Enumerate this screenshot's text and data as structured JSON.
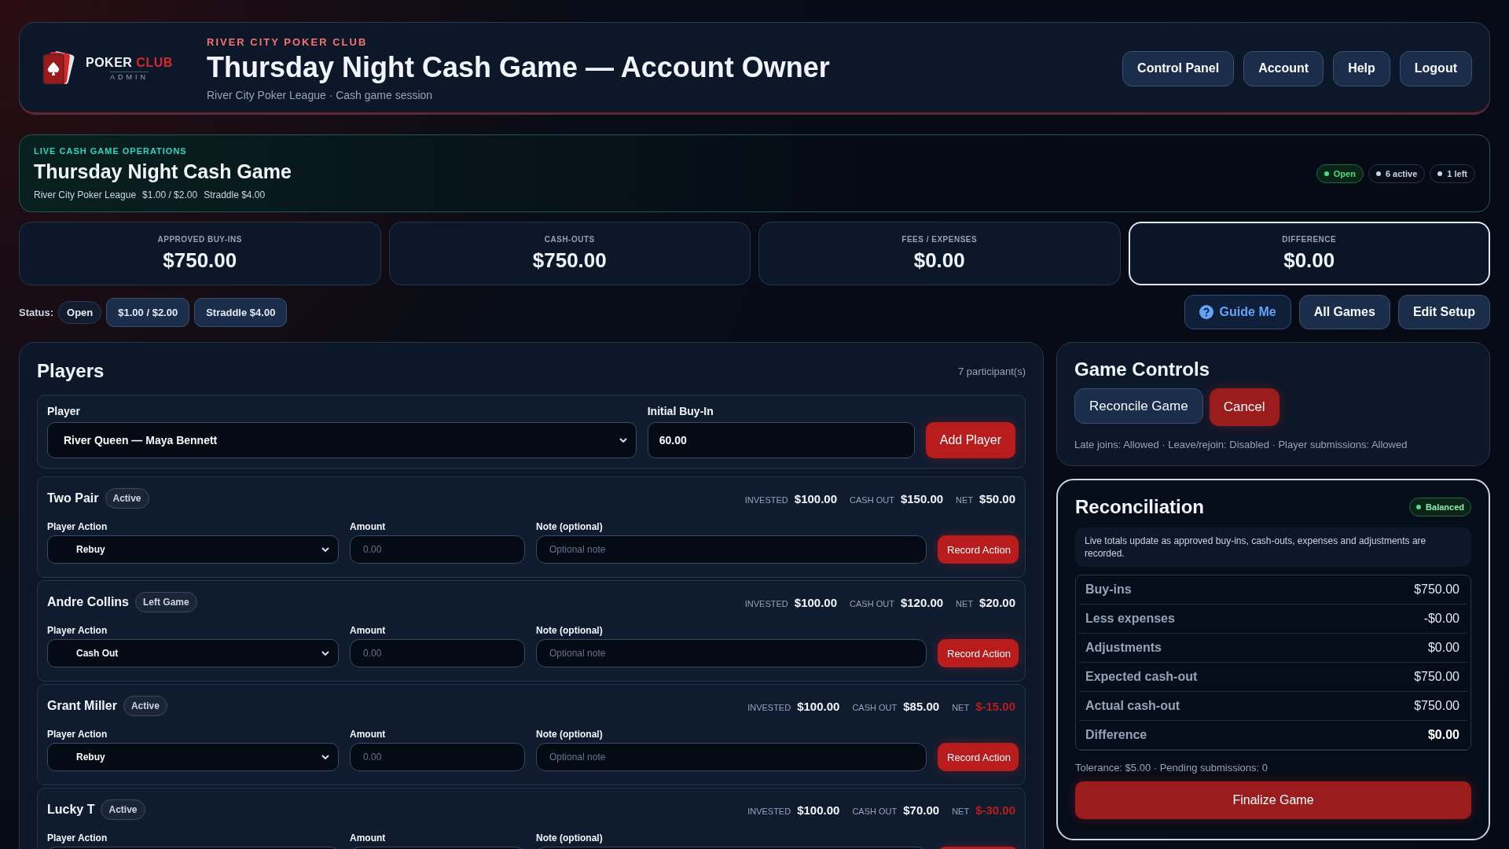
{
  "logo": {
    "word": "POKER",
    "accent": "CLUB",
    "sub": "ADMIN"
  },
  "header": {
    "eyebrow": "RIVER CITY POKER CLUB",
    "title": "Thursday Night Cash Game — Account Owner",
    "subtitle": "River City Poker League · Cash game session",
    "nav": [
      "Control Panel",
      "Account",
      "Help",
      "Logout"
    ]
  },
  "operations": {
    "eyebrow": "LIVE CASH GAME OPERATIONS",
    "title": "Thursday Night Cash Game",
    "meta": [
      "River City Poker League",
      "$1.00 / $2.00",
      "Straddle $4.00"
    ],
    "badges": [
      {
        "label": "Open",
        "kind": "ok"
      },
      {
        "label": "6 active",
        "kind": "neutral"
      },
      {
        "label": "1 left",
        "kind": "neutral"
      }
    ]
  },
  "stats": [
    {
      "label": "APPROVED BUY-INS",
      "value": "$750.00",
      "selected": false
    },
    {
      "label": "CASH-OUTS",
      "value": "$750.00",
      "selected": false
    },
    {
      "label": "FEES / EXPENSES",
      "value": "$0.00",
      "selected": false
    },
    {
      "label": "DIFFERENCE",
      "value": "$0.00",
      "selected": true
    }
  ],
  "status_bar": {
    "label": "Status:",
    "chips": [
      {
        "label": "Open",
        "kind": "plain"
      },
      {
        "label": "$1.00 / $2.00",
        "kind": "pill"
      },
      {
        "label": "Straddle $4.00",
        "kind": "pill"
      }
    ],
    "actions": [
      {
        "label": "Guide Me",
        "kind": "guide"
      },
      {
        "label": "All Games",
        "kind": "normal"
      },
      {
        "label": "Edit Setup",
        "kind": "normal"
      }
    ]
  },
  "players": {
    "title": "Players",
    "count": "7 participant(s)",
    "add": {
      "player_label": "Player",
      "player_value": "River Queen — Maya Bennett",
      "buyin_label": "Initial Buy-In",
      "buyin_value": "60.00",
      "button": "Add Player"
    },
    "rows": [
      {
        "name": "Two Pair",
        "status": "Active",
        "invested_label": "INVESTED",
        "invested": "$100.00",
        "cashout_label": "CASH OUT",
        "cashout": "$150.00",
        "net_label": "NET",
        "net": "$50.00",
        "negative": false,
        "action_label": "Player Action",
        "action": "Rebuy",
        "amount_label": "Amount",
        "amount_placeholder": "0.00",
        "note_label": "Note (optional)",
        "note_placeholder": "Optional note",
        "button": "Record Action"
      },
      {
        "name": "Andre Collins",
        "status": "Left Game",
        "invested_label": "INVESTED",
        "invested": "$100.00",
        "cashout_label": "CASH OUT",
        "cashout": "$120.00",
        "net_label": "NET",
        "net": "$20.00",
        "negative": false,
        "action_label": "Player Action",
        "action": "Cash Out",
        "amount_label": "Amount",
        "amount_placeholder": "0.00",
        "note_label": "Note (optional)",
        "note_placeholder": "Optional note",
        "button": "Record Action"
      },
      {
        "name": "Grant Miller",
        "status": "Active",
        "invested_label": "INVESTED",
        "invested": "$100.00",
        "cashout_label": "CASH OUT",
        "cashout": "$85.00",
        "net_label": "NET",
        "net": "$-15.00",
        "negative": true,
        "action_label": "Player Action",
        "action": "Rebuy",
        "amount_label": "Amount",
        "amount_placeholder": "0.00",
        "note_label": "Note (optional)",
        "note_placeholder": "Optional note",
        "button": "Record Action"
      },
      {
        "name": "Lucky T",
        "status": "Active",
        "invested_label": "INVESTED",
        "invested": "$100.00",
        "cashout_label": "CASH OUT",
        "cashout": "$70.00",
        "net_label": "NET",
        "net": "$-30.00",
        "negative": true,
        "action_label": "Player Action",
        "amount_label": "Amount",
        "note_label": "Note (optional)"
      }
    ]
  },
  "controls": {
    "title": "Game Controls",
    "buttons": [
      {
        "label": "Reconcile Game",
        "kind": "normal"
      },
      {
        "label": "Cancel",
        "kind": "danger"
      }
    ],
    "note": "Late joins: Allowed · Leave/rejoin: Disabled · Player submissions: Allowed"
  },
  "reconciliation": {
    "title": "Reconciliation",
    "badge": "Balanced",
    "info": "Live totals update as approved buy-ins, cash-outs, expenses and adjustments are recorded.",
    "rows": [
      {
        "label": "Buy-ins",
        "value": "$750.00",
        "kind": "line"
      },
      {
        "label": "Less expenses",
        "value": "-$0.00",
        "kind": "line"
      },
      {
        "label": "Adjustments",
        "value": "$0.00",
        "kind": "line"
      },
      {
        "label": "Expected cash-out",
        "value": "$750.00",
        "kind": "line"
      },
      {
        "label": "Actual cash-out",
        "value": "$750.00",
        "kind": "line"
      },
      {
        "label": "Difference",
        "value": "$0.00",
        "kind": "total"
      }
    ],
    "footer": "Tolerance: $5.00 · Pending submissions: 0",
    "button": "Finalize Game"
  }
}
